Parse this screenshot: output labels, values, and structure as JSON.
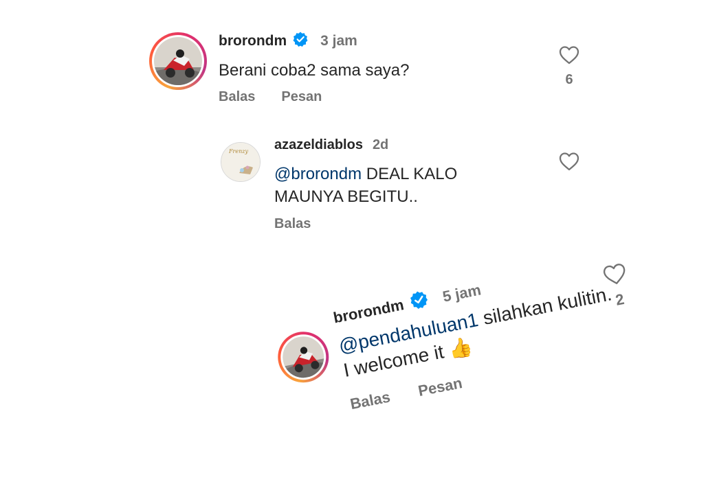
{
  "comments": [
    {
      "username": "brorondm",
      "verified": true,
      "time": "3 jam",
      "text": "Berani coba2 sama saya?",
      "likes": "6",
      "actions": {
        "reply": "Balas",
        "message": "Pesan"
      }
    },
    {
      "username": "azazeldiablos",
      "verified": false,
      "time": "2d",
      "mention": "@brorondm",
      "text": " DEAL KALO MAUNYA BEGITU..",
      "actions": {
        "reply": "Balas"
      }
    },
    {
      "username": "brorondm",
      "verified": true,
      "time": "5 jam",
      "mention": "@pendahuluan1",
      "text_line1": " silahkan kulitin.",
      "text_line2": "I welcome it",
      "emoji": "👍",
      "likes": "2",
      "actions": {
        "reply": "Balas",
        "message": "Pesan"
      }
    }
  ],
  "colors": {
    "text": "#262626",
    "secondary": "#737373",
    "mention": "#00376b",
    "verified": "#0095f6"
  },
  "icons": {
    "like": "heart-outline-icon",
    "verified": "verified-badge-icon"
  }
}
